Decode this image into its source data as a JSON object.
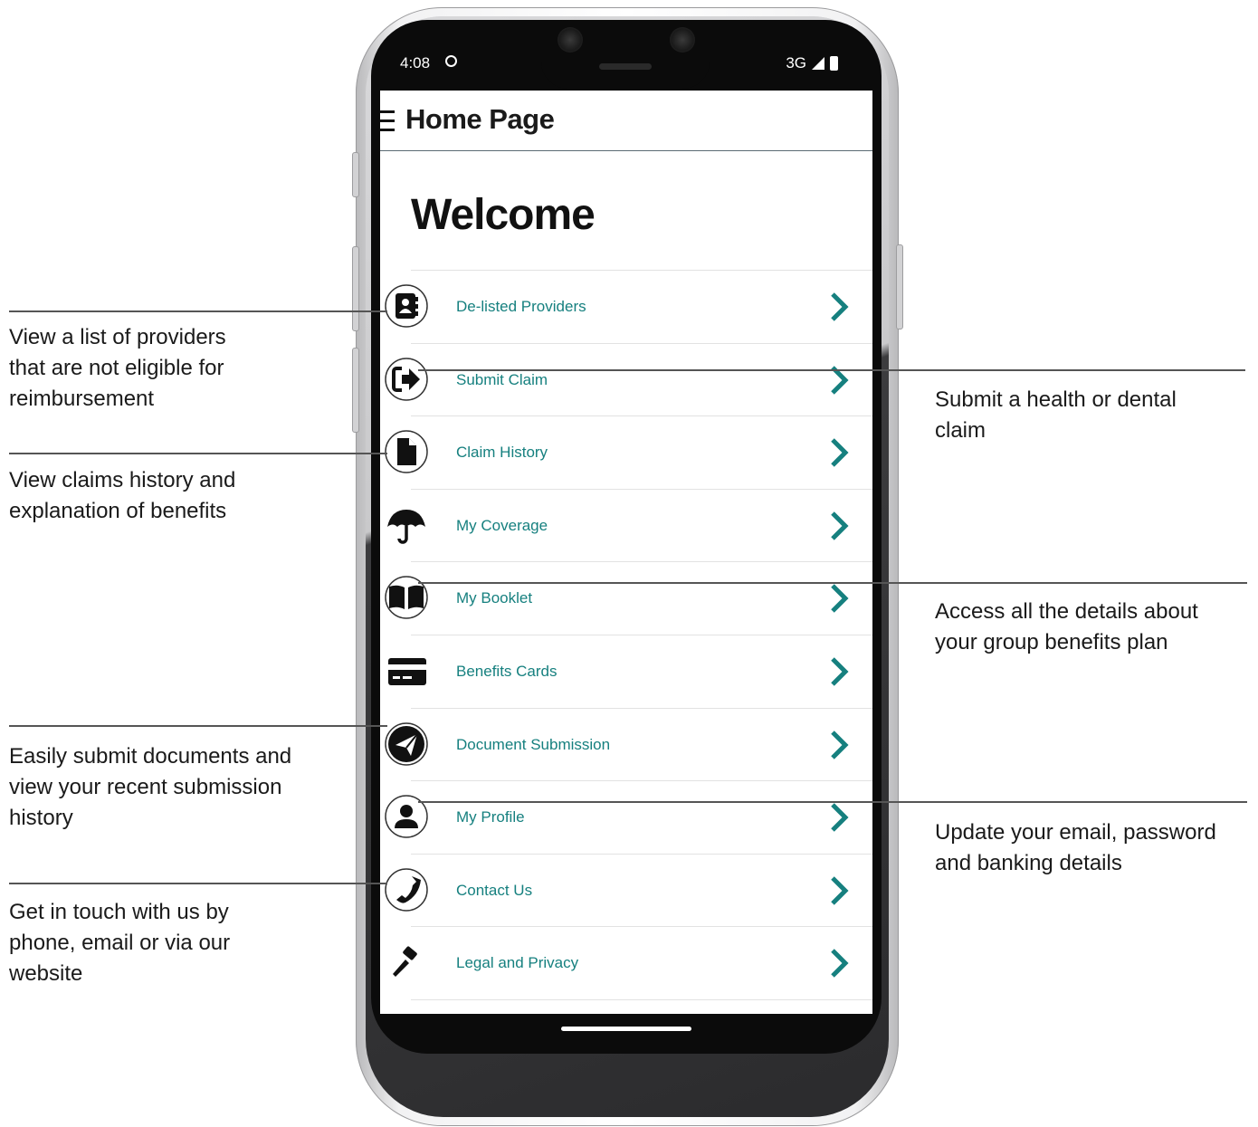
{
  "status_bar": {
    "time": "4:08",
    "network": "3G"
  },
  "app": {
    "title": "Home Page",
    "welcome": "Welcome"
  },
  "menu": {
    "items": [
      {
        "label": "De-listed Providers",
        "icon": "address-book-icon"
      },
      {
        "label": "Submit Claim",
        "icon": "sign-out-arrow-icon"
      },
      {
        "label": "Claim History",
        "icon": "document-icon"
      },
      {
        "label": "My Coverage",
        "icon": "umbrella-icon"
      },
      {
        "label": "My Booklet",
        "icon": "book-icon"
      },
      {
        "label": "Benefits Cards",
        "icon": "credit-card-icon"
      },
      {
        "label": "Document Submission",
        "icon": "paper-plane-icon"
      },
      {
        "label": "My Profile",
        "icon": "user-icon"
      },
      {
        "label": "Contact Us",
        "icon": "phone-icon"
      },
      {
        "label": "Legal and Privacy",
        "icon": "gavel-icon"
      }
    ]
  },
  "callouts": {
    "providers": [
      "View a list of providers",
      "that are not eligible for",
      "reimbursement"
    ],
    "claim_history": [
      "View claims history and",
      "explanation of benefits"
    ],
    "documents": [
      "Easily submit documents and",
      "view your recent submission",
      "history"
    ],
    "contact": [
      "Get in touch with us by",
      "phone, email or via our",
      "website"
    ],
    "submit_claim": [
      "Submit a health or dental",
      "claim"
    ],
    "booklet": [
      "Access all the details about",
      "your group benefits plan"
    ],
    "profile": [
      "Update your email, password",
      "and banking details"
    ]
  },
  "colors": {
    "accent": "#16807f",
    "text": "#1a1a1a"
  }
}
